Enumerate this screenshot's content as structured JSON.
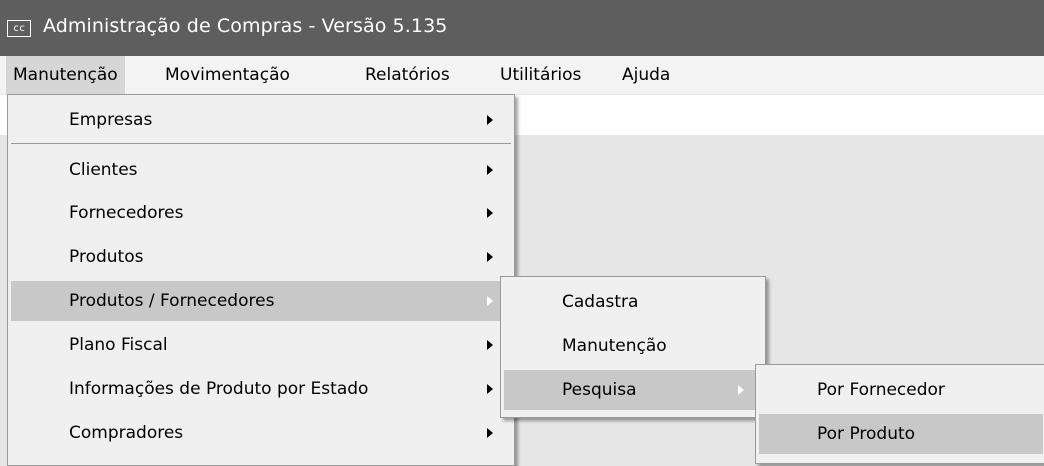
{
  "window": {
    "icon_label": "cc",
    "title": "Administração de Compras - Versão 5.135"
  },
  "menubar": {
    "items": [
      {
        "label": "Manutenção",
        "active": true
      },
      {
        "label": "Movimentação"
      },
      {
        "label": "Relatórios"
      },
      {
        "label": "Utilitários"
      },
      {
        "label": "Ajuda"
      }
    ]
  },
  "manutencao_menu": {
    "items": [
      {
        "label": "Empresas",
        "submenu": true
      },
      {
        "label": "Clientes",
        "submenu": true
      },
      {
        "label": "Fornecedores",
        "submenu": true
      },
      {
        "label": "Produtos",
        "submenu": true
      },
      {
        "label": "Produtos / Fornecedores",
        "submenu": true,
        "highlighted": true
      },
      {
        "label": "Plano Fiscal",
        "submenu": true
      },
      {
        "label": "Informações de Produto por Estado",
        "submenu": true
      },
      {
        "label": "Compradores",
        "submenu": true
      }
    ]
  },
  "produtos_fornecedores_menu": {
    "items": [
      {
        "label": "Cadastra"
      },
      {
        "label": "Manutenção"
      },
      {
        "label": "Pesquisa",
        "submenu": true,
        "highlighted": true
      }
    ]
  },
  "pesquisa_menu": {
    "items": [
      {
        "label": "Por Fornecedor"
      },
      {
        "label": "Por Produto",
        "highlighted": true
      }
    ]
  },
  "colors": {
    "titlebar": "#5e5e5e",
    "menu_background": "#f0f0f0",
    "highlight": "#c8c8c8"
  }
}
